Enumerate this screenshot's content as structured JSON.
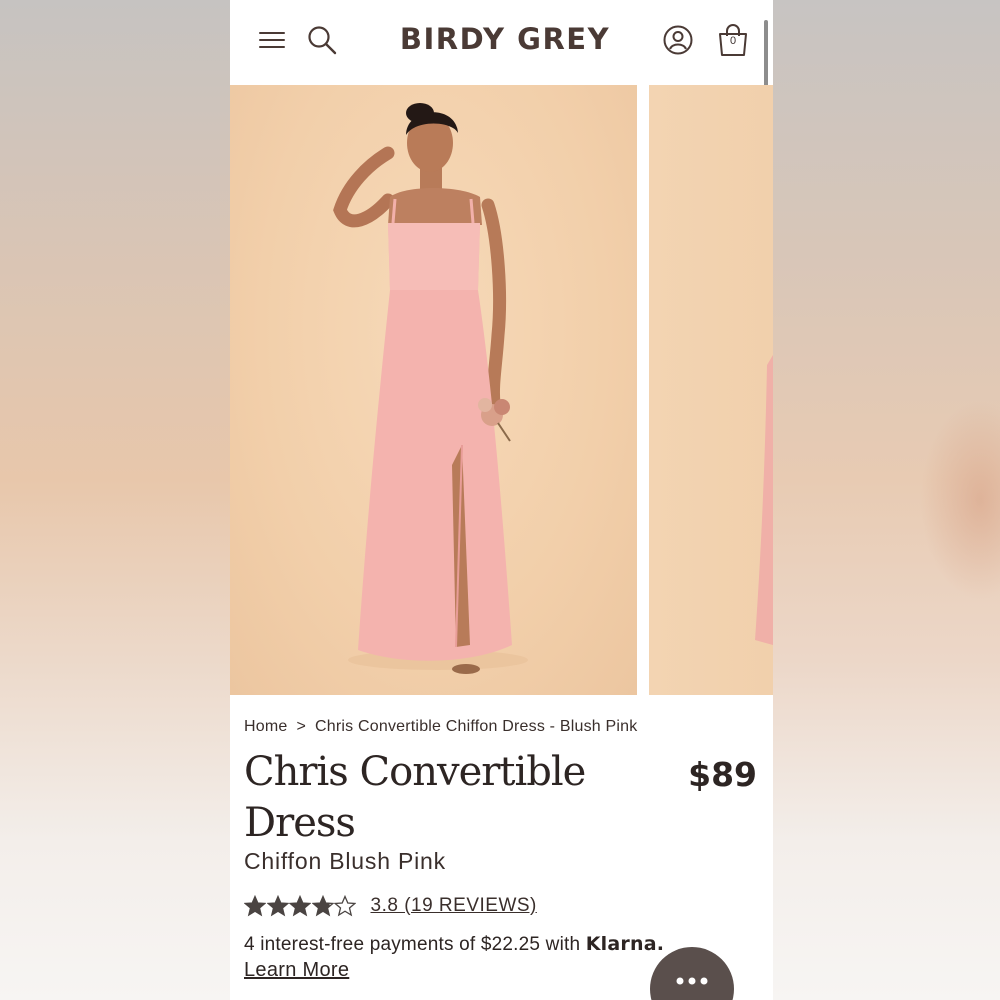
{
  "header": {
    "logo": "BIRDY GREY",
    "cart_count": "0",
    "icons": [
      "menu-icon",
      "search-icon",
      "account-icon",
      "cart-icon"
    ]
  },
  "gallery": {
    "images": [
      "dress-front-photo",
      "dress-second-photo"
    ]
  },
  "breadcrumb": {
    "home": "Home",
    "separator": ">",
    "current": "Chris Convertible Chiffon Dress - Blush Pink"
  },
  "product": {
    "title": "Chris Convertible Dress",
    "price": "$89",
    "subtitle": "Chiffon Blush Pink",
    "rating_value": 3.8,
    "rating_max": 5,
    "reviews_label": "3.8 (19 REVIEWS)"
  },
  "payment": {
    "installment_text": "4 interest-free payments of $22.25 with",
    "provider": "Klarna.",
    "learn_more": "Learn More"
  },
  "colors": {
    "brand_text": "#4a3a35",
    "dress_pink": "#f4b3ae",
    "backdrop_peach": "#f2cfaa",
    "chat_button": "#5a4f4c"
  }
}
